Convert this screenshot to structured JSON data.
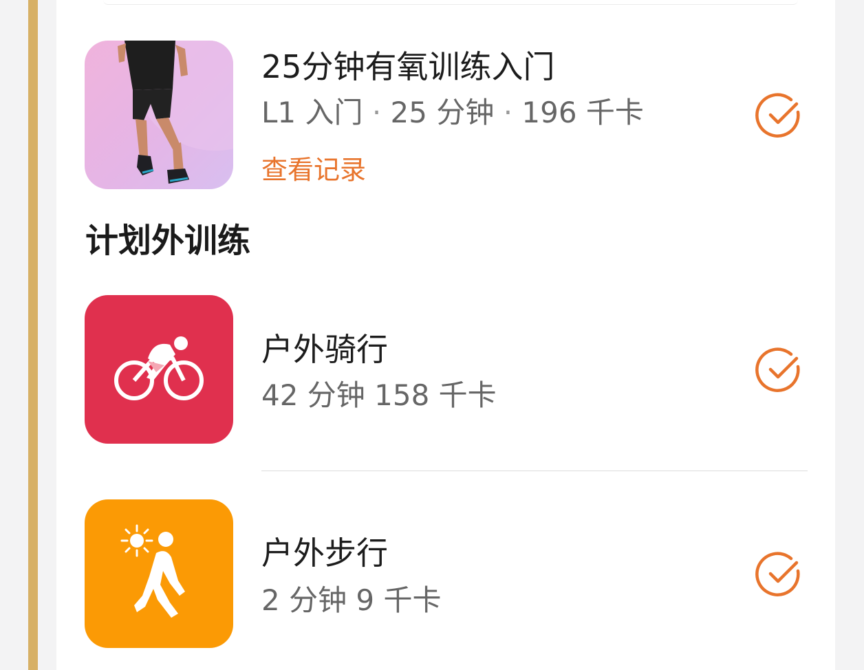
{
  "plan_items": [
    {
      "title": "25分钟有氧训练入门",
      "level": "L1 入门",
      "duration": "25 分钟",
      "calories": "196 千卡",
      "link": "查看记录",
      "thumbnail_icon": "runner-photo",
      "completed": true
    }
  ],
  "extra_section": {
    "title": "计划外训练",
    "items": [
      {
        "title": "户外骑行",
        "meta": "42 分钟 158 千卡",
        "icon": "cycling-icon",
        "icon_bg": "#e0304e",
        "completed": true
      },
      {
        "title": "户外步行",
        "meta": "2 分钟 9 千卡",
        "icon": "walking-sun-icon",
        "icon_bg": "#fb9a05",
        "completed": true
      }
    ]
  },
  "colors": {
    "accent": "#e8742c",
    "gold_bar": "#d7b065"
  }
}
